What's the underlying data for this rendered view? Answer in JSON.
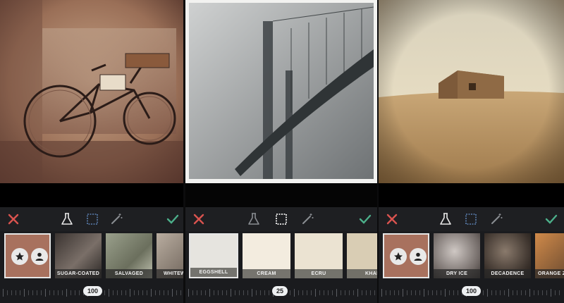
{
  "panels": [
    {
      "id": "vintage-bike",
      "active_tool": "lab",
      "filters": [
        {
          "label": ""
        },
        {
          "label": "SUGAR-COATED"
        },
        {
          "label": "SALVAGED"
        },
        {
          "label": "WHITEWAS"
        }
      ],
      "slider_value": "100"
    },
    {
      "id": "bridge",
      "active_tool": "frame",
      "filters": [
        {
          "label": "EGGSHELL"
        },
        {
          "label": "CREAM"
        },
        {
          "label": "ECRU"
        },
        {
          "label": "KHAKI"
        }
      ],
      "slider_value": "25"
    },
    {
      "id": "barn",
      "active_tool": "lab",
      "filters": [
        {
          "label": ""
        },
        {
          "label": "DRY ICE"
        },
        {
          "label": "DECADENCE"
        },
        {
          "label": "ORANGE ZI"
        }
      ],
      "slider_value": "100"
    }
  ],
  "icons": {
    "cancel": "close-icon",
    "lab": "beaker-icon",
    "frame": "frame-icon",
    "magic": "magic-wand-icon",
    "apply": "check-icon",
    "favorite": "star-icon",
    "user": "person-icon"
  },
  "colors": {
    "cancel": "#d9534f",
    "apply": "#4caf8a",
    "toolbar_bg": "#1e1f22",
    "selected_border": "#e6e6e6",
    "swatch_eggshell": "#e6e4df",
    "swatch_cream": "#f3ecdf",
    "swatch_ecru": "#ebe3d2",
    "swatch_khaki": "#d9cdb4"
  }
}
